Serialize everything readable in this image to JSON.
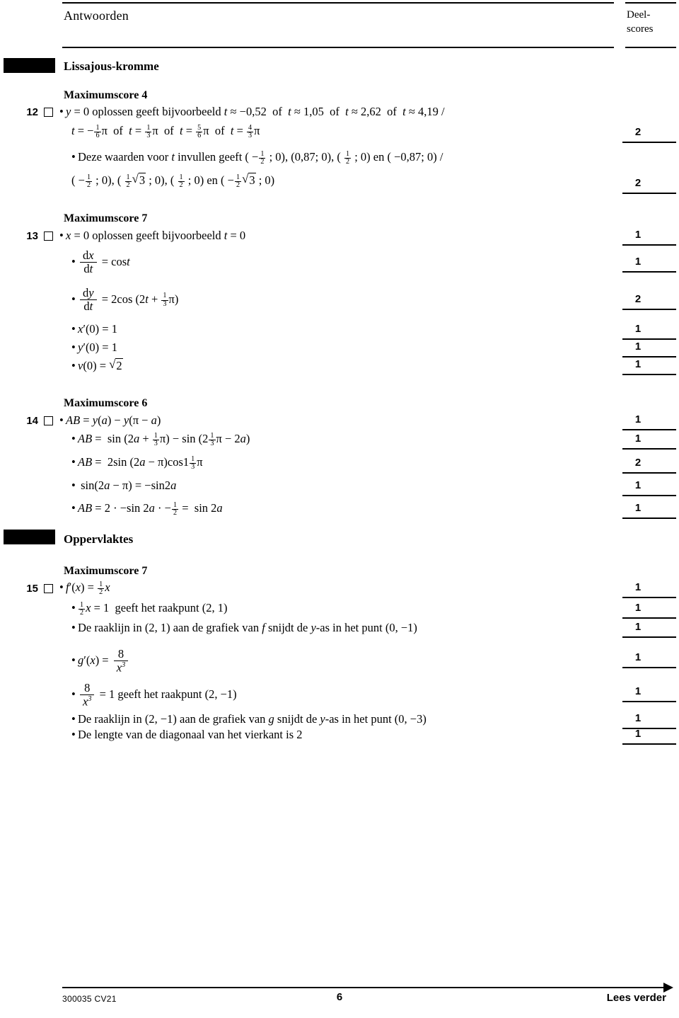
{
  "header": {
    "title": "Antwoorden",
    "score_column_line1": "Deel-",
    "score_column_line2": "scores"
  },
  "sections": [
    {
      "id": "lissajous",
      "title": "Lissajous-kromme"
    },
    {
      "id": "oppervlaktes",
      "title": "Oppervlaktes"
    }
  ],
  "questions": {
    "q12": {
      "number": "12",
      "maximumscore": "Maximumscore 4",
      "line1_a": "• y = 0 oplossen geeft bijvoorbeeld t ≈ −0,52  of  t ≈ 1,05  of  t ≈ 2,62  of  t ≈ 4,19 /",
      "line1_b": "t = − 1/6 π  of  t = 1/3 π  of  t = 5/6 π  of  t = 4/3 π",
      "line2_a": "• Deze waarden voor t invullen geeft ( − 1/2 ; 0), (0,87; 0), ( 1/2 ; 0) en ( −0,87; 0) /",
      "line2_b": "( − 1/2 ; 0), ( 1/2 √3 ; 0), ( 1/2 ; 0) en ( − 1/2 √3 ; 0)",
      "scores": [
        "2",
        "2"
      ]
    },
    "q13": {
      "number": "13",
      "maximumscore": "Maximumscore 7",
      "line1": "• x = 0 oplossen geeft bijvoorbeeld t = 0",
      "line2": "• dx/dt = cos t",
      "line3": "• dy/dt = 2 cos (2t + 1/3 π)",
      "line4": "• x′(0) = 1",
      "line5": "• y′(0) = 1",
      "line6": "• v(0) = √2",
      "scores": [
        "1",
        "1",
        "2",
        "1",
        "1",
        "1"
      ]
    },
    "q14": {
      "number": "14",
      "maximumscore": "Maximumscore 6",
      "line1": "• AB = y(a) − y(π − a)",
      "line2": "• AB = sin (2a + 1/3 π) − sin (2 1/3 π − 2a)",
      "line3": "• AB = 2 sin (2a − π) cos 1 1/3 π",
      "line4": "• sin(2a − π) = −sin2a",
      "line5": "• AB = 2 · −sin 2a · − 1/2  =  sin 2a",
      "scores": [
        "1",
        "1",
        "2",
        "1",
        "1"
      ]
    },
    "q15": {
      "number": "15",
      "maximumscore": "Maximumscore 7",
      "line1": "• f′(x) = 1/2 x",
      "line2": "• 1/2 x = 1 geeft het raakpunt (2, 1)",
      "line3": "• De raaklijn in (2, 1) aan de grafiek van f snijdt de y-as in het punt (0, −1)",
      "line4": "• g′(x) = 8 / x³",
      "line5": "• 8 / x³ = 1 geeft het raakpunt (2, −1)",
      "line6": "• De raaklijn in (2, −1) aan de grafiek van g snijdt de y-as in het punt (0, −3)",
      "line7": "• De lengte van de diagonaal van het vierkant is 2",
      "scores": [
        "1",
        "1",
        "1",
        "1",
        "1",
        "1",
        "1"
      ]
    }
  },
  "footer": {
    "document_code": "300035  CV21",
    "page_number": "6",
    "continue_label": "Lees verder"
  }
}
